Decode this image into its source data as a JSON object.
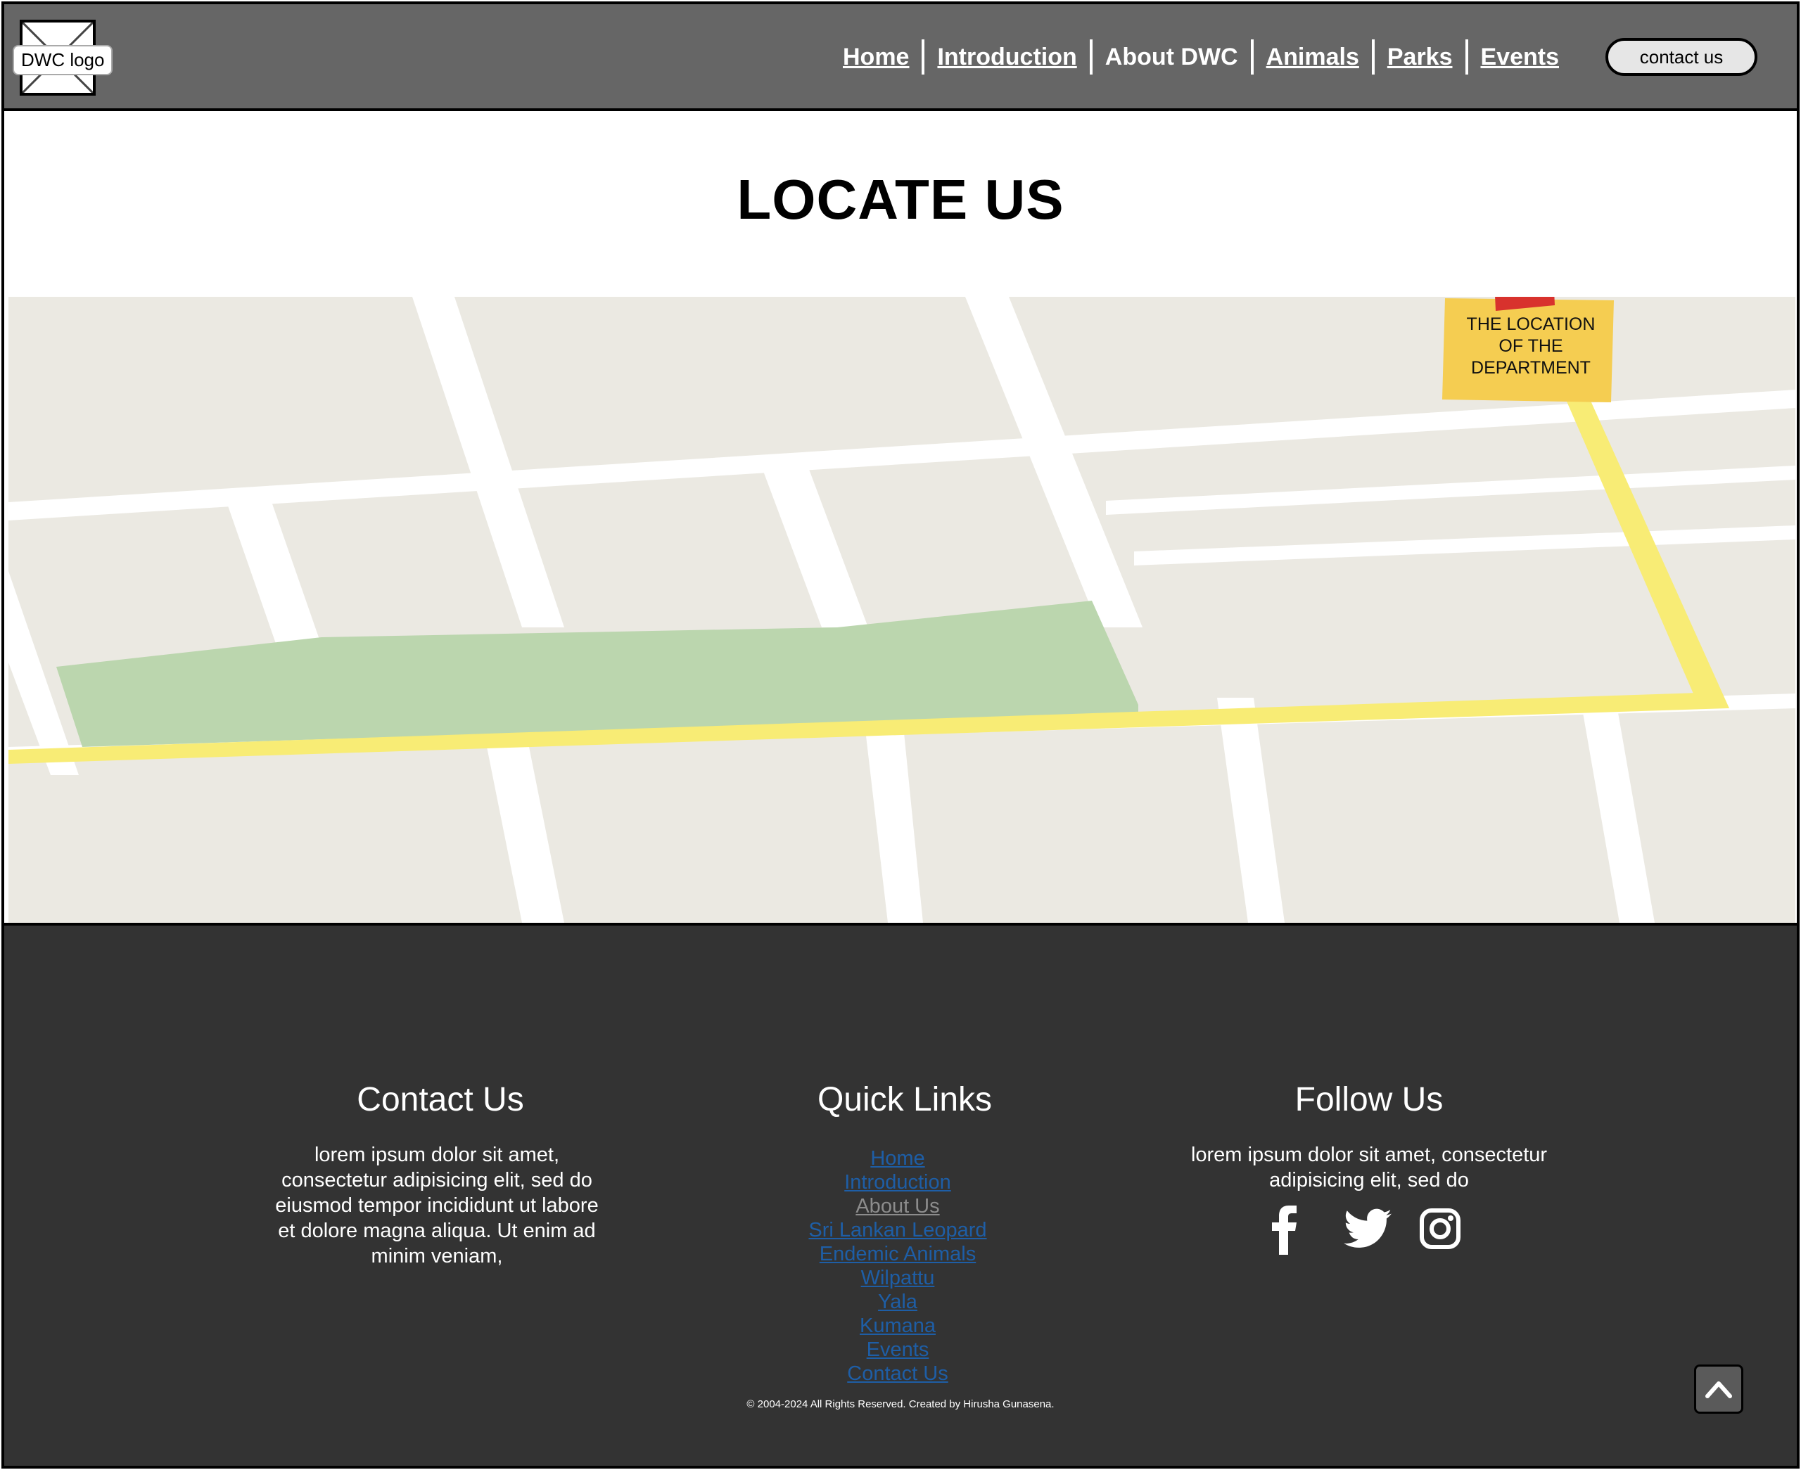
{
  "header": {
    "logo_label": "DWC logo",
    "nav": [
      {
        "label": "Home"
      },
      {
        "label": "Introduction"
      },
      {
        "label": "About DWC"
      },
      {
        "label": "Animals"
      },
      {
        "label": "Parks"
      },
      {
        "label": "Events"
      }
    ],
    "contact_button": "contact us"
  },
  "main": {
    "title": "LOCATE US",
    "map": {
      "note_lines": [
        "THE LOCATION",
        "OF THE",
        "DEPARTMENT"
      ],
      "colors": {
        "block": "#ebe9e2",
        "road": "#ffffff",
        "park": "#bbd6ae",
        "route": "#f8ec75",
        "note": "#f5cd51",
        "tape": "#d8322d"
      }
    }
  },
  "footer": {
    "contact": {
      "title": "Contact Us",
      "text": "lorem ipsum dolor sit amet, consectetur adipisicing elit, sed do eiusmod tempor incididunt ut labore et dolore magna aliqua. Ut enim ad minim veniam,"
    },
    "quick_links": {
      "title": "Quick Links",
      "items": [
        "Home",
        "Introduction",
        "About Us",
        "Sri Lankan Leopard",
        "Endemic Animals",
        "Wilpattu",
        "Yala",
        "Kumana",
        "Events",
        "Contact Us"
      ]
    },
    "follow": {
      "title": "Follow Us",
      "text": "lorem ipsum dolor sit amet, consectetur adipisicing elit, sed do",
      "icons": [
        "facebook-icon",
        "twitter-icon",
        "instagram-icon"
      ]
    },
    "copyright": "© 2004-2024 All Rights Reserved. Created by Hirusha Gunasena."
  }
}
